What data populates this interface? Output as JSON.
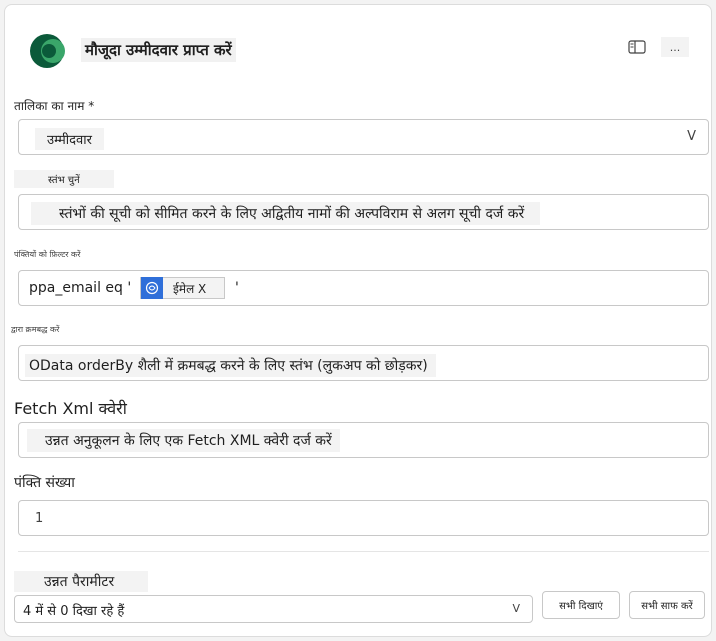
{
  "header": {
    "title": "मौजूदा उम्मीदवार प्राप्त करें",
    "more_label": "...",
    "panel_icon": "side-panel-icon",
    "logo_icon": "dataverse-logo-icon"
  },
  "table_name": {
    "label": "तालिका का नाम *",
    "value": "उम्मीदवार",
    "chevron": "V"
  },
  "select_columns": {
    "label": "स्तंभ चुनें",
    "placeholder": "स्तंभों की सूची को सीमित करने के लिए अद्वितीय नामों की अल्पविराम से अलग सूची दर्ज करें"
  },
  "filter_rows": {
    "label": "पंक्तियों को फ़िल्टर करें",
    "prefix": "ppa_email eq '",
    "token_label": "ईमेल X",
    "suffix": "'",
    "token_icon": "dynamic-content-icon"
  },
  "sort_by": {
    "label": "द्वारा क्रमबद्ध करें",
    "placeholder": "OData orderBy शैली में क्रमबद्ध करने के लिए स्तंभ (लुकअप को छोड़कर)"
  },
  "fetch_xml": {
    "label": "Fetch Xml क्वेरी",
    "placeholder": "उन्नत अनुकूलन के लिए एक Fetch XML क्वेरी दर्ज करें"
  },
  "row_count": {
    "label": "पंक्ति संख्या",
    "value": "1"
  },
  "advanced": {
    "label": "उन्नत पैरामीटर",
    "showing": "4 में से 0 दिखा रहे हैं",
    "chevron": "V",
    "show_all": "सभी दिखाएं",
    "clear_all": "सभी साफ करें"
  },
  "colors": {
    "brand_dark": "#0b5a3a",
    "brand_light": "#3aa66a",
    "token_blue": "#2f6fd9"
  }
}
